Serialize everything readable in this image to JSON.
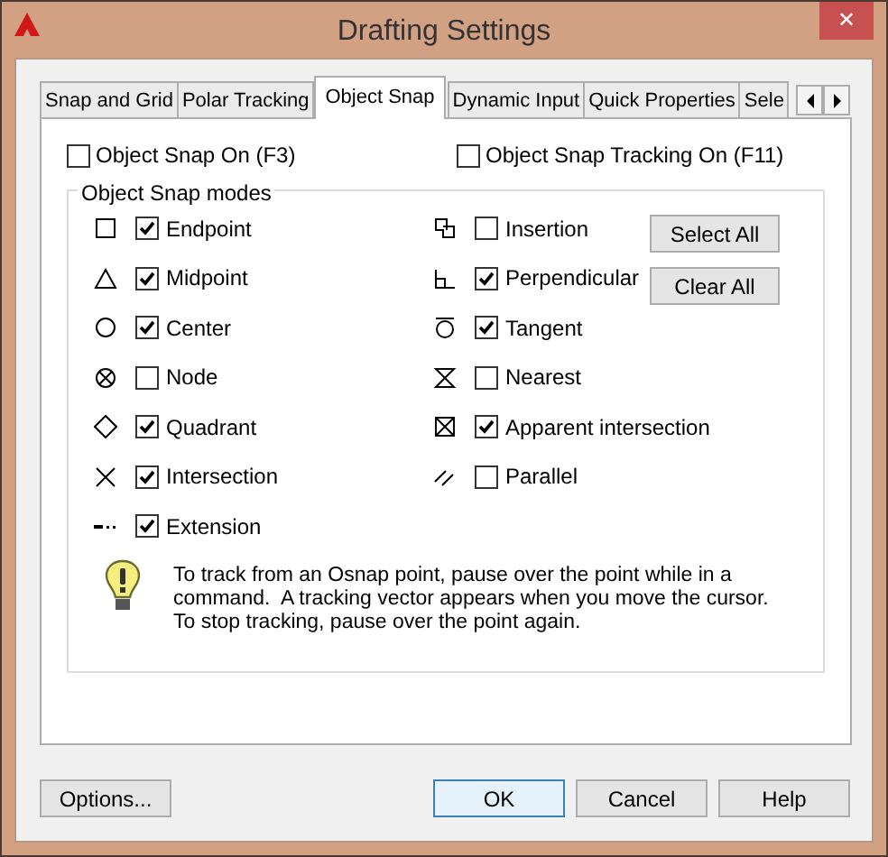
{
  "window": {
    "title": "Drafting Settings",
    "close": "✕"
  },
  "tabs": [
    {
      "label": "Snap and Grid",
      "selected": false
    },
    {
      "label": "Polar Tracking",
      "selected": false
    },
    {
      "label": "Object Snap",
      "selected": true
    },
    {
      "label": "Dynamic Input",
      "selected": false
    },
    {
      "label": "Quick Properties",
      "selected": false
    },
    {
      "label": "Sele",
      "selected": false
    }
  ],
  "object_snap_on": {
    "label": "Object Snap On (F3)",
    "checked": false
  },
  "object_snap_tracking_on": {
    "label": "Object Snap Tracking On (F11)",
    "checked": false
  },
  "modes": {
    "title": "Object Snap modes",
    "left": [
      {
        "kind": "square",
        "label": "Endpoint",
        "checked": true
      },
      {
        "kind": "triangle",
        "label": "Midpoint",
        "checked": true
      },
      {
        "kind": "circle",
        "label": "Center",
        "checked": true
      },
      {
        "kind": "node",
        "label": "Node",
        "checked": false
      },
      {
        "kind": "diamond",
        "label": "Quadrant",
        "checked": true
      },
      {
        "kind": "cross",
        "label": "Intersection",
        "checked": true
      },
      {
        "kind": "extension",
        "label": "Extension",
        "checked": true
      }
    ],
    "right": [
      {
        "kind": "insertion",
        "label": "Insertion",
        "checked": false
      },
      {
        "kind": "perpendicular",
        "label": "Perpendicular",
        "checked": true
      },
      {
        "kind": "tangent",
        "label": "Tangent",
        "checked": true
      },
      {
        "kind": "hourglass",
        "label": "Nearest",
        "checked": false
      },
      {
        "kind": "boxcross",
        "label": "Apparent intersection",
        "checked": true
      },
      {
        "kind": "parallel",
        "label": "Parallel",
        "checked": false
      }
    ],
    "buttons": [
      "Select All",
      "Clear All"
    ],
    "tip": "To track from an Osnap point, pause over the point while in a\ncommand.  A tracking vector appears when you move the cursor.\nTo stop tracking, pause over the point again."
  },
  "buttons": [
    {
      "label": "Options...",
      "focused": false
    },
    {
      "label": "OK",
      "focused": true
    },
    {
      "label": "Cancel",
      "focused": false
    },
    {
      "label": "Help",
      "focused": false
    }
  ]
}
